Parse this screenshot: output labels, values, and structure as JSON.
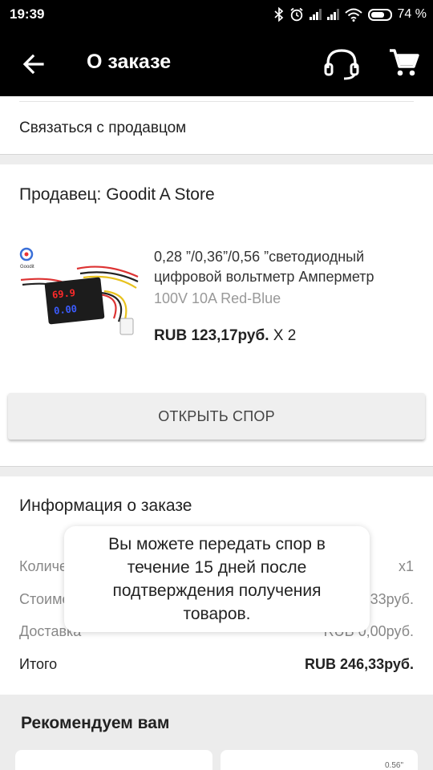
{
  "status_bar": {
    "time": "19:39",
    "battery": "74 %",
    "battery_level": 0.74
  },
  "app_bar": {
    "title": "О заказе",
    "back_icon": "arrow-left-icon",
    "support_icon": "headset-icon",
    "cart_icon": "cart-icon"
  },
  "contact": {
    "label": "Связаться с продавцом"
  },
  "seller": {
    "name": "Продавец: Goodit A Store",
    "product": {
      "title_line1": "0,28 ”/0,36”/0,56 ”светодиодный",
      "title_line2": "цифровой вольтметр Амперметр",
      "variant": "100V 10A Red-Blue",
      "price": "RUB 123,17руб.",
      "quantity": "X 2",
      "brand_logo": "Goodit"
    },
    "dispute_button": "ОТКРЫТЬ СПОР"
  },
  "order_info": {
    "heading": "Информация о заказе",
    "rows": [
      {
        "label": "Количество",
        "value": "x1"
      },
      {
        "label": "Стоимость",
        "value": "RUB 246,33руб."
      },
      {
        "label": "Доставка",
        "value": "RUB 0,00руб."
      },
      {
        "label": "Итого",
        "value": "RUB 246,33руб."
      }
    ]
  },
  "recommend": {
    "heading": "Рекомендуем вам",
    "card2_mini": "0.56\""
  },
  "toast": {
    "text": "Вы можете передать спор в течение 15 дней после подтверждения получения товаров."
  },
  "colors": {
    "app_bar": "#000000",
    "page_gap": "#ededed",
    "button_bg": "#efefef",
    "voltmeter_red": "#ff2222",
    "voltmeter_blue": "#3355ff"
  }
}
